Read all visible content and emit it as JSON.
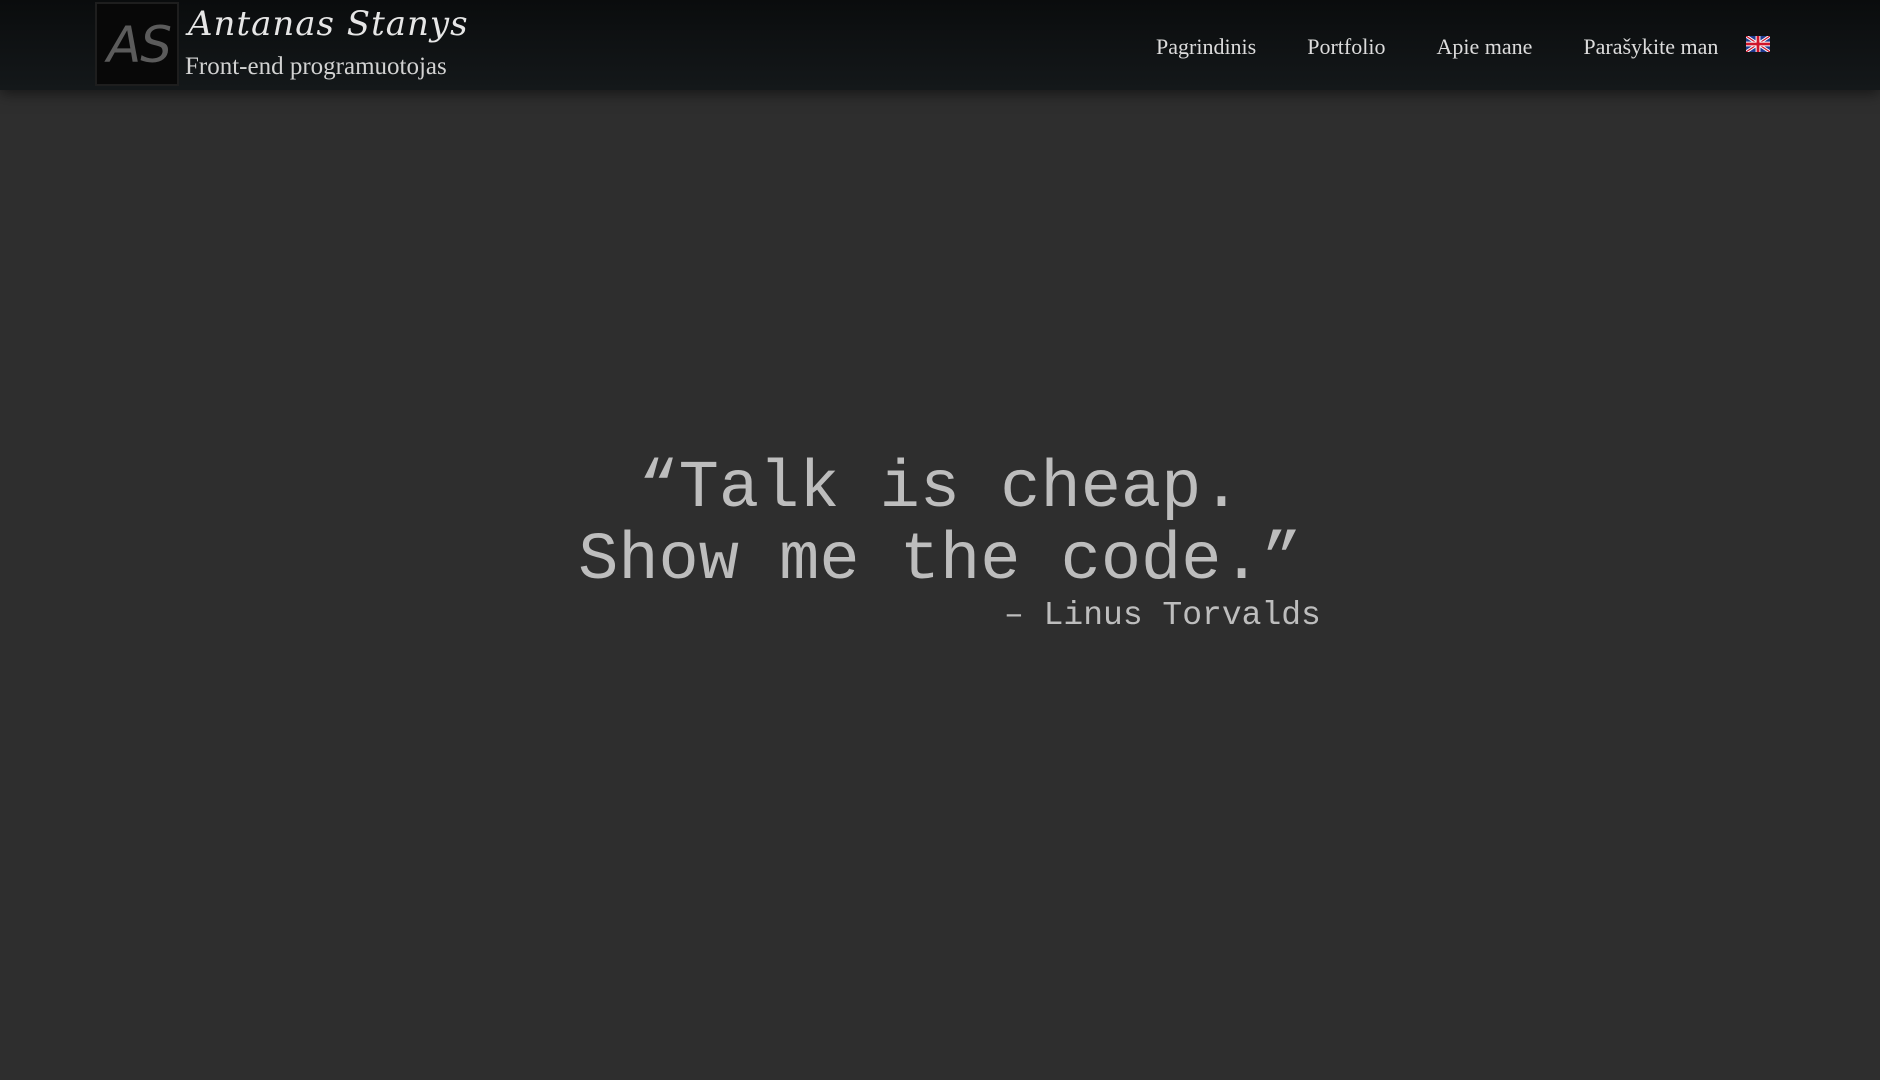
{
  "header": {
    "logo_mark": "AS",
    "brand_name": "Antanas Stanys",
    "brand_subtitle": "Front-end programuotojas"
  },
  "nav": {
    "items": [
      {
        "label": "Pagrindinis"
      },
      {
        "label": "Portfolio"
      },
      {
        "label": "Apie mane"
      },
      {
        "label": "Parašykite man"
      }
    ],
    "language_flag_icon": "uk-flag-icon"
  },
  "quote": {
    "line1": "“Talk is cheap.",
    "line2": "Show me the code.”",
    "attribution": "– Linus Torvalds"
  },
  "colors": {
    "background": "#2e2e2e",
    "header_background": "#0e1113",
    "text": "#bdbdbd"
  }
}
